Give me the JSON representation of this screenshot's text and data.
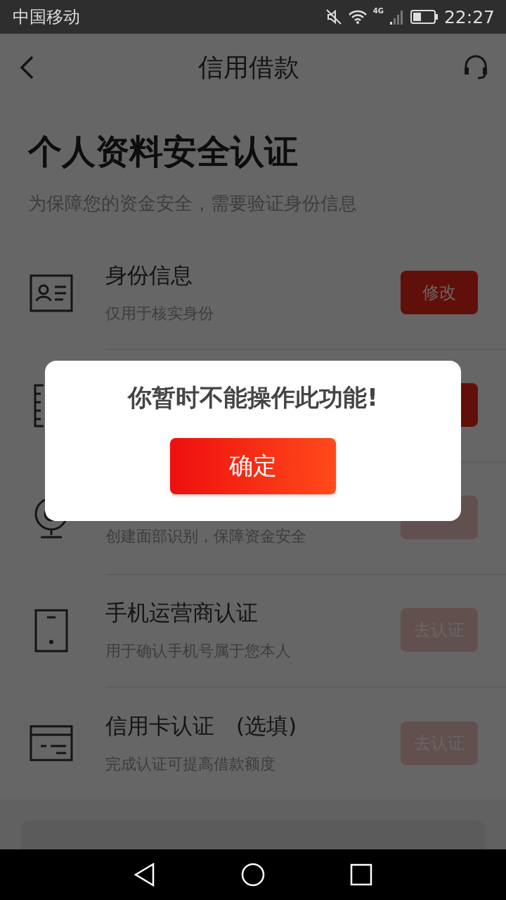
{
  "status_bar": {
    "carrier": "中国移动",
    "network": "4G",
    "time": "22:27"
  },
  "header": {
    "title": "信用借款"
  },
  "heading": "个人资料安全认证",
  "subheading": "为保障您的资金安全，需要验证身份信息",
  "items": [
    {
      "title": "身份信息",
      "subtitle": "仅用于核实身份",
      "button": {
        "label": "修改",
        "active": true
      }
    },
    {
      "button": {
        "active": true
      }
    },
    {
      "subtitle": "创建面部识别，保障资金安全",
      "button": {
        "active": false
      }
    },
    {
      "title": "手机运营商认证",
      "subtitle": "用于确认手机号属于您本人",
      "button": {
        "label": "去认证",
        "active": false
      }
    },
    {
      "title": "信用卡认证　(选填)",
      "subtitle": "完成认证可提高借款额度",
      "button": {
        "label": "去认证",
        "active": false
      }
    }
  ],
  "dialog": {
    "open": true,
    "title": "你暂时不能操作此功能!",
    "button": "确定"
  }
}
